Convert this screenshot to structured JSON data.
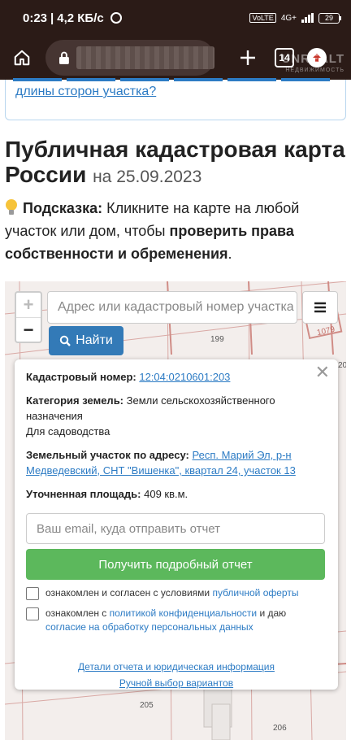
{
  "status": {
    "time": "0:23",
    "speed": "4,2 КБ/с",
    "network": "4G+",
    "volte": "VoLTE",
    "battery": "29"
  },
  "browser": {
    "tab_count": "14",
    "watermark_title": "UNREALT",
    "watermark_sub": "НЕДВИЖИМОСТЬ"
  },
  "page": {
    "prev_link_text": "длины сторон участка?",
    "title": "Публичная кадастровая карта России",
    "title_date": "на 25.09.2023",
    "hint_label": "Подсказка:",
    "hint_text1": "Кликните на карте на любой участок или дом, чтобы",
    "hint_bold": "проверить права собственности и обременения",
    "hint_end": "."
  },
  "map": {
    "search_placeholder": "Адрес или кадастровый номер участка",
    "zoom_in": "+",
    "zoom_out": "−",
    "find_label": "Найти",
    "lot_labels": [
      "199",
      "1079",
      "205",
      "206",
      "20"
    ]
  },
  "popup": {
    "cad_label": "Кадастровый номер:",
    "cad_value": "12:04:0210601:203",
    "cat_label": "Категория земель:",
    "cat_value": "Земли сельскохозяйственного назначения",
    "cat_use": "Для садоводства",
    "addr_label": "Земельный участок по адресу:",
    "addr_value": "Респ. Марий Эл, р-н Медведевский, СНТ \"Вишенка\", квартал 24, участок 13",
    "area_label": "Уточненная площадь:",
    "area_value": "409 кв.м.",
    "email_placeholder": "Ваш email, куда отправить отчет",
    "get_button": "Получить подробный отчет",
    "chk1_text": "ознакомлен и согласен с условиями",
    "chk1_link": "публичной оферты",
    "chk2_text": "ознакомлен с",
    "chk2_link1": "политикой конфиденциальности",
    "chk2_mid": "и даю",
    "chk2_link2": "согласие на обработку персональных данных",
    "link_details": "Детали отчета и юридическая информация",
    "link_manual": "Ручной выбор вариантов"
  }
}
